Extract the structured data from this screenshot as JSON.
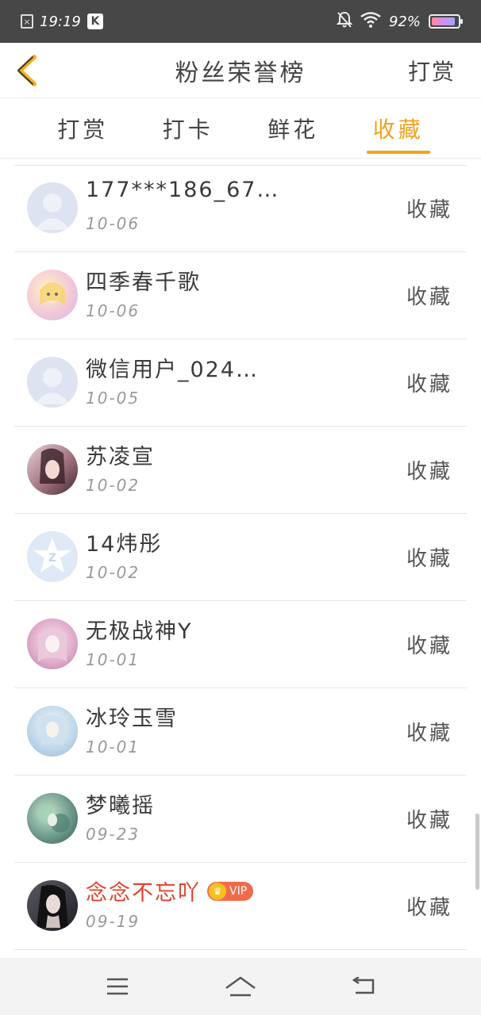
{
  "status_bar": {
    "time": "19:19",
    "notif_icon_x": "x-icon",
    "app_icon": "K",
    "battery": "92%",
    "battery_level": 0.92
  },
  "header": {
    "title": "粉丝荣誉榜",
    "action_label": "打赏"
  },
  "tabs": [
    {
      "label": "打赏",
      "active": false
    },
    {
      "label": "打卡",
      "active": false
    },
    {
      "label": "鲜花",
      "active": false
    },
    {
      "label": "收藏",
      "active": true
    }
  ],
  "colors": {
    "accent": "#f2a21d",
    "vip_name": "#e3412b",
    "status_bar_bg": "#474747"
  },
  "fans": [
    {
      "name": "177***186_67…",
      "date": "10-06",
      "action": "收藏",
      "avatar": "default-user-avatar",
      "vip": false
    },
    {
      "name": "四季春千歌",
      "date": "10-06",
      "action": "收藏",
      "avatar": "anime-girl-avatar",
      "vip": false
    },
    {
      "name": "微信用户_024…",
      "date": "10-05",
      "action": "收藏",
      "avatar": "default-user-avatar",
      "vip": false
    },
    {
      "name": "苏凌宣",
      "date": "10-02",
      "action": "收藏",
      "avatar": "girl-photo-avatar",
      "vip": false
    },
    {
      "name": "14炜彤",
      "date": "10-02",
      "action": "收藏",
      "avatar": "qq-star-avatar",
      "vip": false
    },
    {
      "name": "无极战神Y",
      "date": "10-01",
      "action": "收藏",
      "avatar": "anime-pink-avatar",
      "vip": false
    },
    {
      "name": "冰玲玉雪",
      "date": "10-01",
      "action": "收藏",
      "avatar": "anime-blue-avatar",
      "vip": false
    },
    {
      "name": "梦曦摇",
      "date": "09-23",
      "action": "收藏",
      "avatar": "nature-avatar",
      "vip": false
    },
    {
      "name": "念念不忘吖",
      "date": "09-19",
      "action": "收藏",
      "avatar": "dark-girl-avatar",
      "vip": true,
      "vip_label": "VIP"
    }
  ],
  "nav_bar": {
    "menu_icon": "menu-icon",
    "home_icon": "home-icon",
    "back_icon": "back-icon"
  }
}
